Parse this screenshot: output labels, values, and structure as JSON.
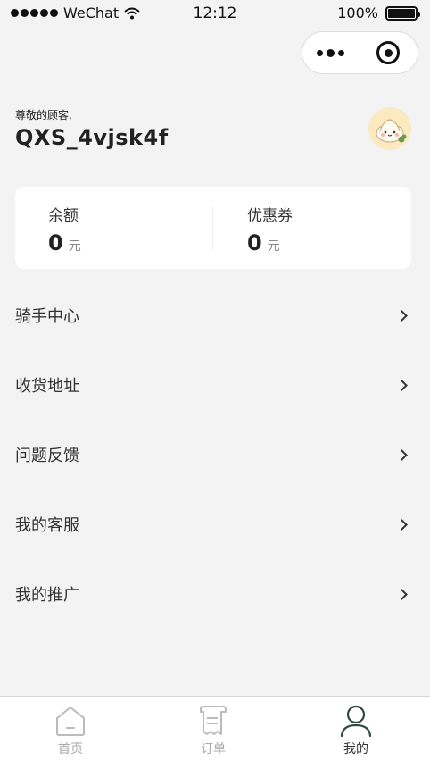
{
  "status_bar": {
    "carrier": "WeChat",
    "time": "12:12",
    "battery": "100%",
    "battery_level": 1.0
  },
  "capsule": {
    "menu_icon": "more-dots-icon",
    "close_icon": "target-close-icon"
  },
  "profile": {
    "greeting": "尊敬的顾客,",
    "username": "QXS_4vjsk4f",
    "avatar_icon": "bun-avatar-icon"
  },
  "wallet": {
    "balance_label": "余额",
    "balance_value": "0",
    "balance_unit": "元",
    "coupon_label": "优惠券",
    "coupon_value": "0",
    "coupon_unit": "元"
  },
  "menu": [
    {
      "label": "骑手中心",
      "icon": "chevron-right-icon"
    },
    {
      "label": "收货地址",
      "icon": "chevron-right-icon"
    },
    {
      "label": "问题反馈",
      "icon": "chevron-right-icon"
    },
    {
      "label": "我的客服",
      "icon": "chevron-right-icon"
    },
    {
      "label": "我的推广",
      "icon": "chevron-right-icon"
    }
  ],
  "tabbar": {
    "tabs": [
      {
        "label": "首页",
        "icon": "home-icon",
        "active": false
      },
      {
        "label": "订单",
        "icon": "receipt-icon",
        "active": false
      },
      {
        "label": "我的",
        "icon": "user-icon",
        "active": true
      }
    ],
    "active_color": "#2e4a3e",
    "inactive_color": "#aaaaaa"
  }
}
